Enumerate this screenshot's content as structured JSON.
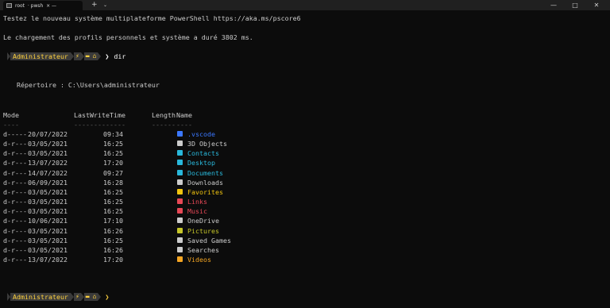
{
  "window": {
    "tab_title": "root  · pwsh  × —",
    "new_tab_label": "+",
    "dropdown_label": "⌄",
    "minimize_label": "—",
    "maximize_label": "□",
    "close_label": "✕"
  },
  "intro": {
    "line1": "Testez le nouveau système multiplateforme PowerShell https://aka.ms/pscore6",
    "line2": "Le chargement des profils personnels et système a duré 3802 ms."
  },
  "prompt": {
    "user": "Administrateur",
    "command": "dir"
  },
  "directory_label": "Répertoire : C:\\Users\\administrateur",
  "table": {
    "headers": {
      "mode": "Mode",
      "lastwritetime": "LastWriteTime",
      "length": "Length",
      "name": "Name"
    },
    "underlines": {
      "mode": "----",
      "lastwritetime": "-------------",
      "length": "------",
      "name": "----"
    },
    "rows": [
      {
        "mode": "d-----",
        "date": "20/07/2022",
        "time": "09:34",
        "name": ".vscode",
        "color": "#3b78ff",
        "icon": "vscode-icon"
      },
      {
        "mode": "d-r---",
        "date": "03/05/2021",
        "time": "16:25",
        "name": "3D Objects",
        "color": "#cccccc",
        "icon": "folder-icon"
      },
      {
        "mode": "d-r---",
        "date": "03/05/2021",
        "time": "16:25",
        "name": "Contacts",
        "color": "#29b8db",
        "icon": "contacts-icon"
      },
      {
        "mode": "d-r---",
        "date": "13/07/2022",
        "time": "17:20",
        "name": "Desktop",
        "color": "#29b8db",
        "icon": "desktop-icon"
      },
      {
        "mode": "d-r---",
        "date": "14/07/2022",
        "time": "09:27",
        "name": "Documents",
        "color": "#29b8db",
        "icon": "documents-icon"
      },
      {
        "mode": "d-r---",
        "date": "06/09/2021",
        "time": "16:28",
        "name": "Downloads",
        "color": "#cccccc",
        "icon": "downloads-icon"
      },
      {
        "mode": "d-r---",
        "date": "03/05/2021",
        "time": "16:25",
        "name": "Favorites",
        "color": "#f1c40f",
        "icon": "favorites-icon"
      },
      {
        "mode": "d-r---",
        "date": "03/05/2021",
        "time": "16:25",
        "name": "Links",
        "color": "#e74856",
        "icon": "links-icon"
      },
      {
        "mode": "d-r---",
        "date": "03/05/2021",
        "time": "16:25",
        "name": "Music",
        "color": "#e74856",
        "icon": "music-icon"
      },
      {
        "mode": "d-r---",
        "date": "10/06/2021",
        "time": "17:10",
        "name": "OneDrive",
        "color": "#cccccc",
        "icon": "onedrive-icon"
      },
      {
        "mode": "d-r---",
        "date": "03/05/2021",
        "time": "16:26",
        "name": "Pictures",
        "color": "#c6c629",
        "icon": "pictures-icon"
      },
      {
        "mode": "d-r---",
        "date": "03/05/2021",
        "time": "16:25",
        "name": "Saved Games",
        "color": "#cccccc",
        "icon": "saved-games-icon"
      },
      {
        "mode": "d-r---",
        "date": "03/05/2021",
        "time": "16:26",
        "name": "Searches",
        "color": "#cccccc",
        "icon": "searches-icon"
      },
      {
        "mode": "d-r---",
        "date": "13/07/2022",
        "time": "17:20",
        "name": "Videos",
        "color": "#f5a623",
        "icon": "videos-icon"
      }
    ]
  }
}
